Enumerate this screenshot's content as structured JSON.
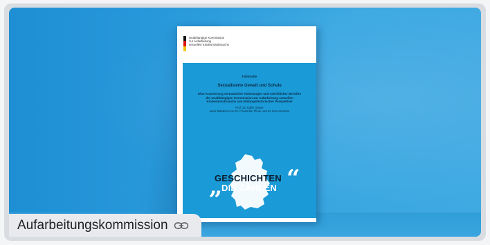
{
  "booklet": {
    "logo_text": "Unabhängige Kommission\nzur Aufarbeitung\nsexuellen Kindesmissbrauchs",
    "series": "Fallstudie",
    "title": "Sexualisierte Gewalt und Schule",
    "subtitle": "Eine Auswertung vertraulicher Anhörungen und schriftlicher Berichte der Unabhängigen Kommission zur Aufarbeitung sexuellen Kindesmissbrauchs aus bildungshistorischer Perspektive",
    "author": "Prof. Dr. Edith Glaser",
    "coauthors": "unter Mitarbeit von Dr. Friederike Thole und Dr. Eva Cromme",
    "slogan_line1": "GESCHICHTEN",
    "slogan_line2": "DIE ZÄHLEN",
    "quote_open": "„",
    "quote_close": "“"
  },
  "caption": {
    "label": "Aufarbeitungskommission",
    "icon": "link-icon"
  },
  "colors": {
    "background_blue": "#2a9bdb",
    "cover_blue": "#1a9ad6",
    "caption_bg": "#e9eaed"
  }
}
